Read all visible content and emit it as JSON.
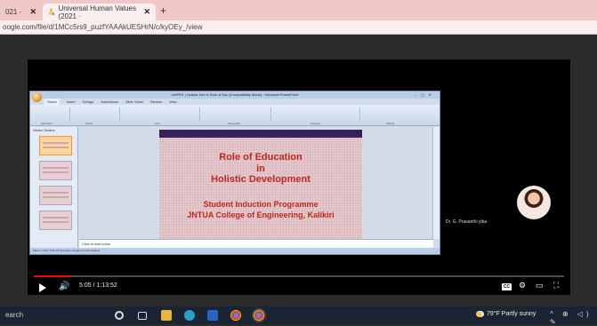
{
  "browser": {
    "tabs": [
      {
        "label": "021 ·"
      },
      {
        "label": "Universal Human Values (2021 ·"
      }
    ],
    "new_tab": "+",
    "url": "oogle.com/file/d/1MCc5rs9_puzfYAAAkUESHrN/c/kyOEy_/view"
  },
  "powerpoint": {
    "window_title": "UHPES | Holistic Dev & Role of Edu [Compatibility Mode] - Microsoft PowerPoint",
    "ribbon_tabs": [
      "Home",
      "Insert",
      "Design",
      "Animations",
      "Slide Show",
      "Review",
      "View"
    ],
    "ribbon_groups": [
      "Clipboard",
      "Slides",
      "Font",
      "Paragraph",
      "Drawing",
      "Editing"
    ],
    "outline_tabs": "Slides  Outline",
    "notes_placeholder": "Click to add notes",
    "status": "Slide 1 of 56   \"SOS PP Template\"   English (United States)",
    "slide": {
      "title_lines": [
        "Role of Education",
        "in",
        "Holistic Development"
      ],
      "subtitle_lines": [
        "Student Induction Programme",
        "JNTUA College of Engineering, Kalikiri"
      ]
    }
  },
  "presenter": {
    "name": "Dr. G. Prasanthi yiba"
  },
  "player": {
    "current_time": "5:05",
    "duration": "1:13:52",
    "time_display": "5:05 / 1:13:52",
    "progress_fraction": 0.069,
    "cc_label": "CC"
  },
  "taskbar": {
    "search": "earch",
    "weather": "79°F  Partly sunny",
    "tray": "^ ⊕ ◁) ✎"
  },
  "colors": {
    "tabstrip": "#f0c8c8",
    "slide_title": "#c0281e",
    "slide_bar": "#3a1f5d",
    "progress": "#ff0000"
  }
}
